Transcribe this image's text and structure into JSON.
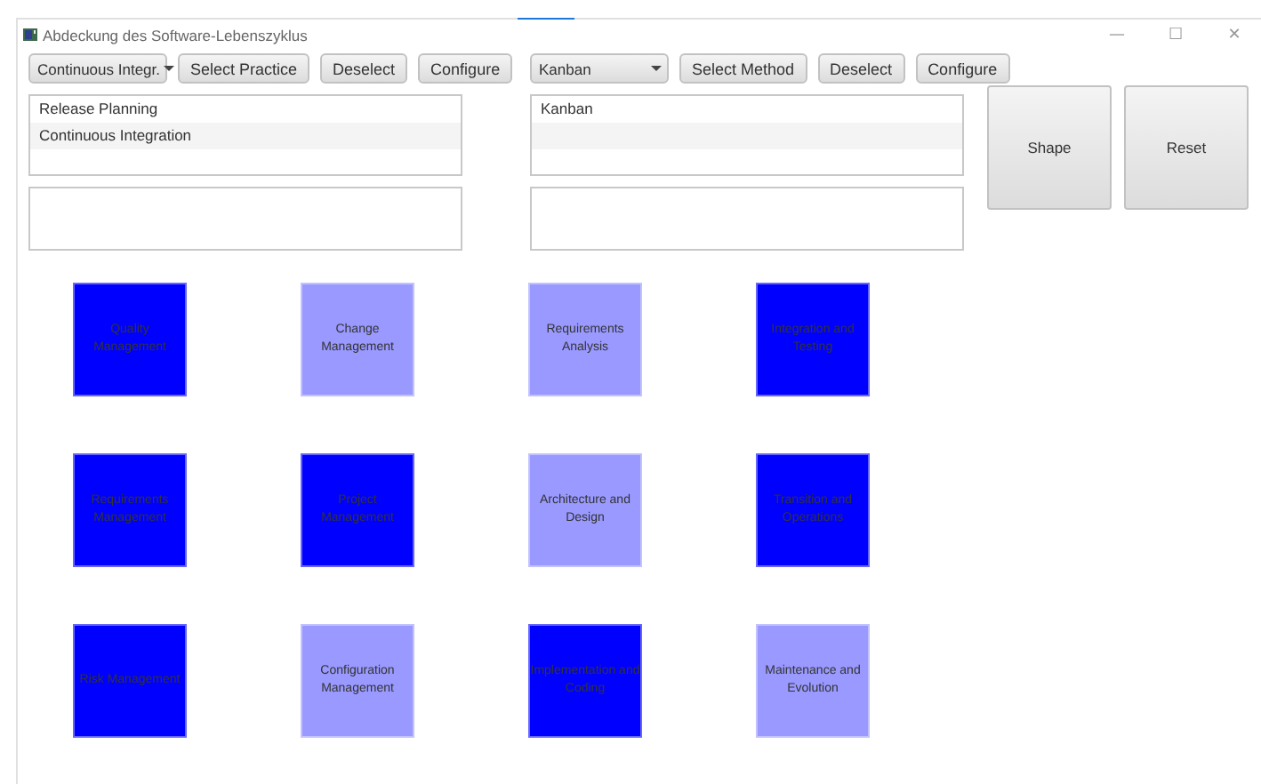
{
  "window": {
    "title": "Abdeckung des Software-Lebenszyklus",
    "controls": [
      "—",
      "☐",
      "✕"
    ]
  },
  "panels": [
    {
      "dropdown": {
        "value": "Continuous Integr."
      },
      "buttons": [
        "Select Practice",
        "Deselect",
        "Configure"
      ],
      "list": [
        "Release Planning",
        "Continuous Integration"
      ]
    },
    {
      "dropdown": {
        "value": "Kanban"
      },
      "buttons": [
        "Select Method",
        "Deselect",
        "Configure"
      ],
      "list": [
        "Kanban"
      ]
    }
  ],
  "actions": [
    "Shape",
    "Reset"
  ],
  "tiles": [
    {
      "label": "Quality Management",
      "color": "#0000ff"
    },
    {
      "label": "Change Management",
      "color": "#9999ff"
    },
    {
      "label": "Requirements Analysis",
      "color": "#9999ff"
    },
    {
      "label": "Integration and Testing",
      "color": "#0000ff"
    },
    {
      "label": "Requirements Management",
      "color": "#0000ff"
    },
    {
      "label": "Project Management",
      "color": "#0000ff"
    },
    {
      "label": "Architecture and Design",
      "color": "#9999ff"
    },
    {
      "label": "Transition and Operations",
      "color": "#0000ff"
    },
    {
      "label": "Risk Management",
      "color": "#0000ff"
    },
    {
      "label": "Configuration Management",
      "color": "#9999ff"
    },
    {
      "label": "Implementation and Coding",
      "color": "#0000ff"
    },
    {
      "label": "Maintenance and Evolution",
      "color": "#9999ff"
    }
  ]
}
